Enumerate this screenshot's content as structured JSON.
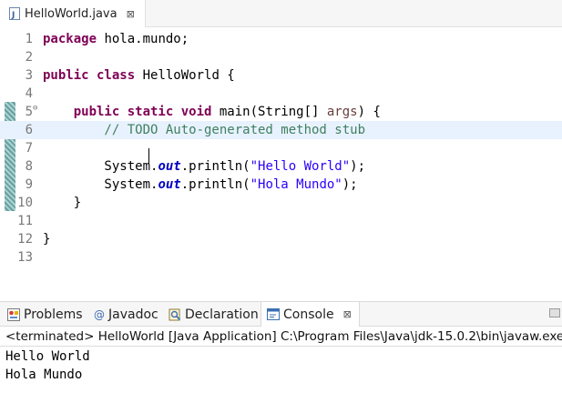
{
  "editor": {
    "tab": {
      "label": "HelloWorld.java",
      "close": "⊠"
    },
    "lines": [
      {
        "no": "1",
        "parts": [
          {
            "t": "package",
            "c": "kw"
          },
          {
            "t": " hola.mundo;",
            "c": ""
          }
        ]
      },
      {
        "no": "2",
        "parts": []
      },
      {
        "no": "3",
        "parts": [
          {
            "t": "public class",
            "c": "kw"
          },
          {
            "t": " HelloWorld {",
            "c": ""
          }
        ]
      },
      {
        "no": "4",
        "parts": []
      },
      {
        "no": "5",
        "parts": [
          {
            "t": "    ",
            "c": ""
          },
          {
            "t": "public static void",
            "c": "kw"
          },
          {
            "t": " main(String[] ",
            "c": ""
          },
          {
            "t": "args",
            "c": "param"
          },
          {
            "t": ") {",
            "c": ""
          }
        ]
      },
      {
        "no": "6",
        "parts": [
          {
            "t": "        // TODO Auto-generated method stub",
            "c": "comment"
          }
        ]
      },
      {
        "no": "7",
        "parts": []
      },
      {
        "no": "8",
        "parts": [
          {
            "t": "        System.",
            "c": ""
          },
          {
            "t": "out",
            "c": "field"
          },
          {
            "t": ".println(",
            "c": ""
          },
          {
            "t": "\"Hello World\"",
            "c": "str"
          },
          {
            "t": ");",
            "c": ""
          }
        ]
      },
      {
        "no": "9",
        "parts": [
          {
            "t": "        System.",
            "c": ""
          },
          {
            "t": "out",
            "c": "field"
          },
          {
            "t": ".println(",
            "c": ""
          },
          {
            "t": "\"Hola Mundo\"",
            "c": "str"
          },
          {
            "t": ");",
            "c": ""
          }
        ]
      },
      {
        "no": "10",
        "parts": [
          {
            "t": "    }",
            "c": ""
          }
        ]
      },
      {
        "no": "11",
        "parts": []
      },
      {
        "no": "12",
        "parts": [
          {
            "t": "}",
            "c": ""
          }
        ]
      },
      {
        "no": "13",
        "parts": []
      }
    ],
    "scroll_left": "<"
  },
  "panel": {
    "tabs": {
      "problems": "Problems",
      "javadoc": "Javadoc",
      "declaration": "Declaration",
      "console": "Console",
      "console_close": "⊠",
      "javadoc_icon_glyph": "@"
    },
    "console_status": "<terminated> HelloWorld [Java Application] C:\\Program Files\\Java\\jdk-15.0.2\\bin\\javaw.exe",
    "output": [
      "Hello World",
      "Hola Mundo"
    ]
  },
  "colors": {
    "keyword": "#7f0055",
    "comment": "#3f7f5f",
    "string": "#2a00ff",
    "field": "#0000c0",
    "current_line": "#e8f2fe"
  }
}
